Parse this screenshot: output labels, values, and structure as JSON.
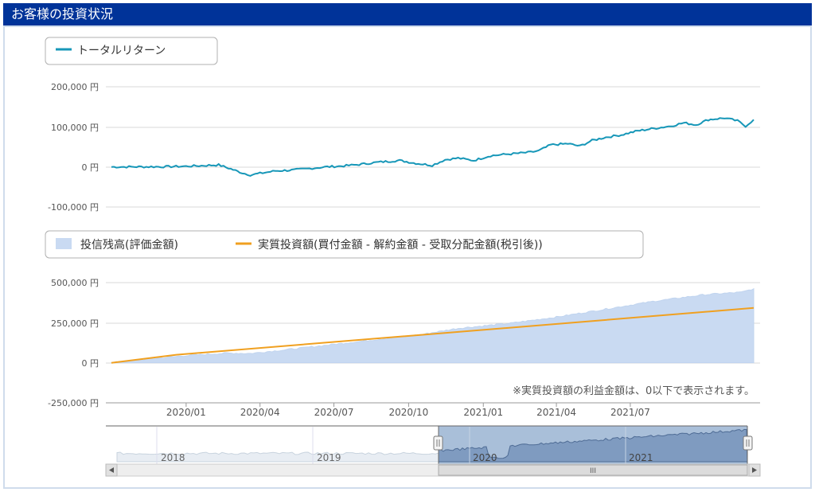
{
  "header": {
    "title": "お客様の投資状況"
  },
  "chart_data": [
    {
      "type": "line",
      "legend": [
        "トータルリターン"
      ],
      "y_ticks": [
        "200,000 円",
        "100,000 円",
        "0 円",
        "-100,000 円"
      ],
      "ylim": [
        -100000,
        200000
      ],
      "grid": true,
      "legend_position": "top-left",
      "series": [
        {
          "name": "トータルリターン",
          "color": "#1797b8",
          "points": [
            [
              "2019-10-01",
              0
            ],
            [
              "2019-11-01",
              200
            ],
            [
              "2019-12-01",
              500
            ],
            [
              "2020-01-01",
              1500
            ],
            [
              "2020-01-20",
              3000
            ],
            [
              "2020-02-10",
              5000
            ],
            [
              "2020-02-25",
              -5000
            ],
            [
              "2020-03-10",
              -15000
            ],
            [
              "2020-03-20",
              -20000
            ],
            [
              "2020-04-01",
              -16000
            ],
            [
              "2020-04-20",
              -10000
            ],
            [
              "2020-05-10",
              -8000
            ],
            [
              "2020-06-01",
              -4000
            ],
            [
              "2020-06-20",
              0
            ],
            [
              "2020-07-10",
              2000
            ],
            [
              "2020-08-01",
              6000
            ],
            [
              "2020-08-25",
              12000
            ],
            [
              "2020-09-20",
              16000
            ],
            [
              "2020-10-10",
              9000
            ],
            [
              "2020-10-30",
              4000
            ],
            [
              "2020-11-15",
              18000
            ],
            [
              "2020-12-01",
              22000
            ],
            [
              "2020-12-20",
              16000
            ],
            [
              "2021-01-10",
              28000
            ],
            [
              "2021-02-01",
              32000
            ],
            [
              "2021-02-25",
              36000
            ],
            [
              "2021-03-10",
              40000
            ],
            [
              "2021-03-25",
              55000
            ],
            [
              "2021-04-15",
              58000
            ],
            [
              "2021-04-30",
              52000
            ],
            [
              "2021-05-15",
              66000
            ],
            [
              "2021-06-01",
              74000
            ],
            [
              "2021-06-20",
              80000
            ],
            [
              "2021-07-10",
              90000
            ],
            [
              "2021-07-30",
              96000
            ],
            [
              "2021-08-20",
              102000
            ],
            [
              "2021-09-05",
              110000
            ],
            [
              "2021-09-20",
              105000
            ],
            [
              "2021-10-05",
              118000
            ],
            [
              "2021-10-25",
              122000
            ],
            [
              "2021-11-10",
              115000
            ],
            [
              "2021-11-20",
              102000
            ],
            [
              "2021-11-30",
              118000
            ]
          ]
        }
      ]
    },
    {
      "type": "area",
      "legend": [
        "投信残高(評価金額)",
        "実質投資額(買付金額 - 解約金額 - 受取分配金額(税引後))"
      ],
      "y_ticks": [
        "500,000 円",
        "250,000 円",
        "0 円",
        "-250,000 円"
      ],
      "ylim": [
        -250000,
        500000
      ],
      "x_ticks": [
        "2020/01",
        "2020/04",
        "2020/07",
        "2020/10",
        "2021/01",
        "2021/04",
        "2021/07"
      ],
      "grid": true,
      "legend_position": "top-left",
      "note": "※実質投資額の利益金額は、0以下で表示されます。",
      "series": [
        {
          "name": "投信残高(評価金額)",
          "color": "#c9daf2",
          "points": [
            [
              "2019-10-01",
              0
            ],
            [
              "2019-12-01",
              30000
            ],
            [
              "2020-01-01",
              45000
            ],
            [
              "2020-02-20",
              60000
            ],
            [
              "2020-03-20",
              58000
            ],
            [
              "2020-05-01",
              80000
            ],
            [
              "2020-07-01",
              115000
            ],
            [
              "2020-09-01",
              150000
            ],
            [
              "2020-10-15",
              175000
            ],
            [
              "2020-12-01",
              215000
            ],
            [
              "2021-02-01",
              245000
            ],
            [
              "2021-04-01",
              285000
            ],
            [
              "2021-06-01",
              335000
            ],
            [
              "2021-08-01",
              385000
            ],
            [
              "2021-10-01",
              425000
            ],
            [
              "2021-11-15",
              440000
            ],
            [
              "2021-11-30",
              462000
            ]
          ]
        },
        {
          "name": "実質投資額(買付金額 - 解約金額 - 受取分配金額(税引後))",
          "color": "#f0a020",
          "points": [
            [
              "2019-10-01",
              0
            ],
            [
              "2019-12-20",
              50000
            ],
            [
              "2021-11-30",
              342000
            ]
          ]
        }
      ]
    }
  ],
  "navigator": {
    "labels": [
      "2018",
      "2019",
      "2020",
      "2021"
    ],
    "scroll_thumb_label": "III",
    "range": [
      "2019-10-01",
      "2021-11-30"
    ]
  }
}
